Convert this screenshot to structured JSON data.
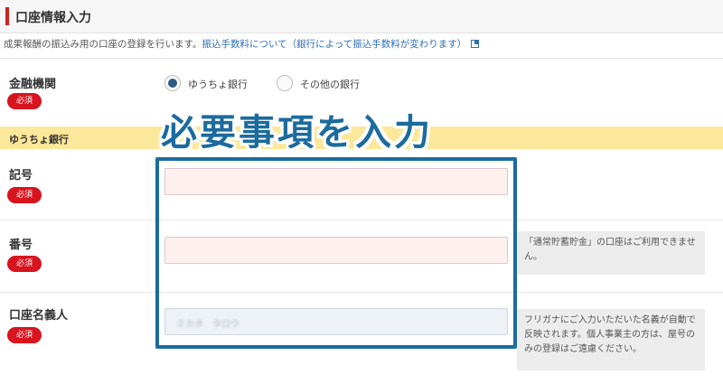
{
  "section": {
    "title": "口座情報入力"
  },
  "description": {
    "text": "成果報酬の振込み用の口座の登録を行います。",
    "link_text": "振込手数料について（銀行によって振込手数料が変わります）"
  },
  "bank_field": {
    "label": "金融機関",
    "required_badge": "必須",
    "options": [
      {
        "label": "ゆうちょ銀行",
        "selected": true
      },
      {
        "label": "その他の銀行",
        "selected": false
      }
    ]
  },
  "subsection": {
    "title": "ゆうちょ銀行"
  },
  "callout": {
    "text": "必要事項を入力"
  },
  "fields": {
    "symbol": {
      "label": "記号",
      "required_badge": "必須",
      "value": ""
    },
    "number": {
      "label": "番号",
      "required_badge": "必須",
      "value": "",
      "note": "「通常貯蓄貯金」の口座はご利用できません。"
    },
    "holder": {
      "label": "口座名義人",
      "required_badge": "必須",
      "placeholder": "ミカタ　タロウ",
      "note": "フリガナにご入力いただいた名義が自動で反映されます。個人事業主の方は、屋号のみの登録はご遠慮ください。"
    }
  },
  "colors": {
    "accent_red": "#d8141e",
    "link_blue": "#2f6fb5",
    "highlight_blue": "#1c6b9e",
    "subsection_yellow": "#fbe89a"
  }
}
